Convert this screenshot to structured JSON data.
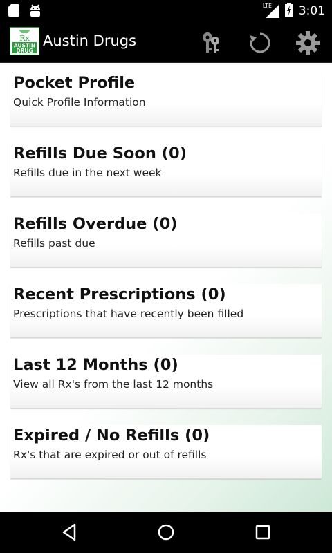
{
  "status_bar": {
    "time": "3:01",
    "network": "LTE",
    "icons": [
      "sd-card-icon",
      "android-icon",
      "signal-icon",
      "battery-icon"
    ]
  },
  "action_bar": {
    "title": "Austin Drugs",
    "logo_text": "AUSTIN DRUG",
    "icons": [
      "keys-icon",
      "refresh-icon",
      "settings-icon"
    ]
  },
  "menu": {
    "items": [
      {
        "title": "Pocket Profile",
        "subtitle": "Quick Profile Information"
      },
      {
        "title": "Refills Due Soon (0)",
        "subtitle": "Refills due in the next week"
      },
      {
        "title": "Refills Overdue (0)",
        "subtitle": "Refills past due"
      },
      {
        "title": "Recent Prescriptions (0)",
        "subtitle": "Prescriptions that have recently been filled"
      },
      {
        "title": "Last 12 Months (0)",
        "subtitle": "View all Rx's from the last 12 months"
      },
      {
        "title": "Expired / No Refills (0)",
        "subtitle": "Rx's that are expired or out of refills"
      }
    ]
  },
  "nav_bar": {
    "icons": [
      "back-icon",
      "home-icon",
      "recents-icon"
    ]
  },
  "colors": {
    "brand_green": "#2a9a3c",
    "background_tint": "#cce8d6"
  }
}
